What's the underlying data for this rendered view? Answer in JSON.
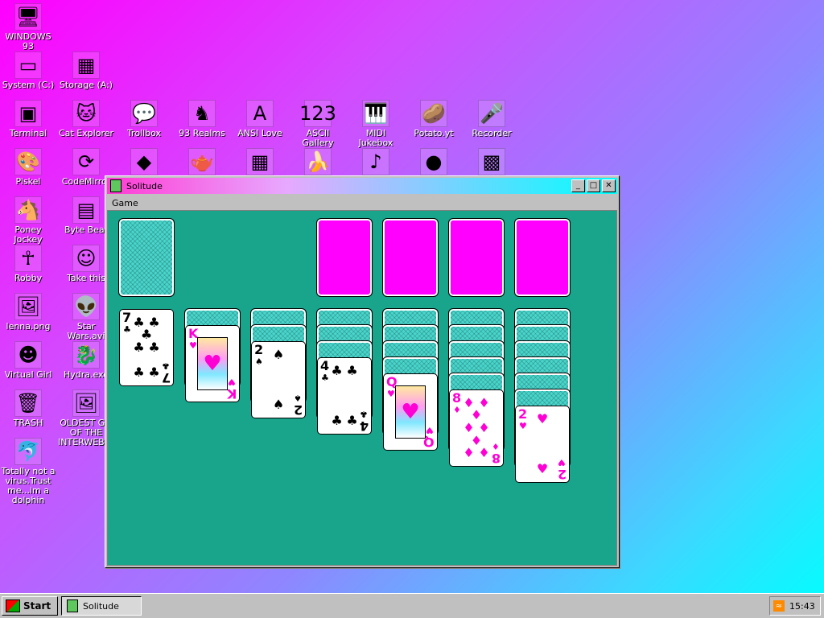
{
  "desktop": {
    "icons": [
      {
        "label": "WINDOWS 93",
        "icon": "computer-icon",
        "glyph": "🖥"
      },
      {
        "label": "System (C:)",
        "icon": "drive-icon",
        "glyph": "▭"
      },
      {
        "label": "Storage (A:)",
        "icon": "floppy-drive-icon",
        "glyph": "▦"
      },
      {
        "label": "Terminal",
        "icon": "terminal-icon",
        "glyph": "▣"
      },
      {
        "label": "Cat Explorer",
        "icon": "cat-globe-icon",
        "glyph": "🐱"
      },
      {
        "label": "Trollbox",
        "icon": "chat-icon",
        "glyph": "💬"
      },
      {
        "label": "93 Realms",
        "icon": "knight-icon",
        "glyph": "♞"
      },
      {
        "label": "ANSI Love",
        "icon": "ansi-icon",
        "glyph": "A"
      },
      {
        "label": "ASCII Gallery",
        "icon": "ascii-icon",
        "glyph": "123"
      },
      {
        "label": "MIDI Jukebox",
        "icon": "piano-icon",
        "glyph": "🎹"
      },
      {
        "label": "Potato.yt",
        "icon": "potato-icon",
        "glyph": "🥔"
      },
      {
        "label": "Recorder",
        "icon": "microphone-icon",
        "glyph": "🎤"
      },
      {
        "label": "Piskel",
        "icon": "palette-icon",
        "glyph": "🎨"
      },
      {
        "label": "CodeMirror",
        "icon": "codemirror-icon",
        "glyph": "⟳"
      },
      {
        "label": "Poney Jockey",
        "icon": "pony-icon",
        "glyph": "🐴"
      },
      {
        "label": "Byte Beat",
        "icon": "bytebeat-icon",
        "glyph": "▤"
      },
      {
        "label": "Robby",
        "icon": "stickman-icon",
        "glyph": "☥"
      },
      {
        "label": "Take this",
        "icon": "character-icon",
        "glyph": "☺"
      },
      {
        "label": "lenna.png",
        "icon": "image-file-icon",
        "glyph": "🖼"
      },
      {
        "label": "Star Wars.avi",
        "icon": "yoda-icon",
        "glyph": "👽"
      },
      {
        "label": "Virtual Girl",
        "icon": "girl-icon",
        "glyph": "☻"
      },
      {
        "label": "Hydra.exe",
        "icon": "hydra-icon",
        "glyph": "🐉"
      },
      {
        "label": "TRASH",
        "icon": "trash-icon",
        "glyph": "🗑"
      },
      {
        "label": "OLDEST GIF OF THE INTERWEB.gif",
        "icon": "gif-file-icon",
        "glyph": "🖼"
      },
      {
        "label": "Totally not a virus.Trust me...im a dolphin",
        "icon": "dolphin-icon",
        "glyph": "🐬"
      },
      {
        "label": "",
        "icon": "cube-icon",
        "glyph": "◆"
      },
      {
        "label": "",
        "icon": "teapot-icon",
        "glyph": "🫖"
      },
      {
        "label": "",
        "icon": "calculator-icon",
        "glyph": "▦"
      },
      {
        "label": "",
        "icon": "banana-icon",
        "glyph": "🍌"
      },
      {
        "label": "",
        "icon": "sound-file-icon",
        "glyph": "♪"
      },
      {
        "label": "",
        "icon": "ball-icon",
        "glyph": "●"
      },
      {
        "label": "",
        "icon": "maze-icon",
        "glyph": "▩"
      }
    ]
  },
  "window": {
    "title": "Solitude",
    "menu": [
      "Game"
    ],
    "minimize": "_",
    "maximize": "□",
    "close": "✕"
  },
  "game": {
    "stock": {
      "count_visible": 1
    },
    "foundations": [
      {
        "empty": true
      },
      {
        "empty": true
      },
      {
        "empty": true
      },
      {
        "empty": true
      }
    ],
    "tableau": [
      {
        "hidden": 0,
        "top": {
          "rank": "7",
          "suit": "♣",
          "color": "black",
          "label": "7 of clubs"
        }
      },
      {
        "hidden": 1,
        "top": {
          "rank": "K",
          "suit": "♥",
          "color": "red",
          "label": "K of hearts",
          "face": true
        }
      },
      {
        "hidden": 2,
        "top": {
          "rank": "2",
          "suit": "♠",
          "color": "black",
          "label": "2 of spades"
        }
      },
      {
        "hidden": 3,
        "top": {
          "rank": "4",
          "suit": "♣",
          "color": "black",
          "label": "4 of clubs"
        }
      },
      {
        "hidden": 4,
        "top": {
          "rank": "Q",
          "suit": "♥",
          "color": "red",
          "label": "Q of hearts",
          "face": true
        }
      },
      {
        "hidden": 5,
        "top": {
          "rank": "8",
          "suit": "♦",
          "color": "red",
          "label": "8 of diamonds"
        }
      },
      {
        "hidden": 6,
        "top": {
          "rank": "2",
          "suit": "♥",
          "color": "red",
          "label": "2 of hearts"
        }
      }
    ]
  },
  "taskbar": {
    "start_label": "Start",
    "tasks": [
      {
        "label": "Solitude"
      }
    ],
    "clock": "15:43"
  }
}
